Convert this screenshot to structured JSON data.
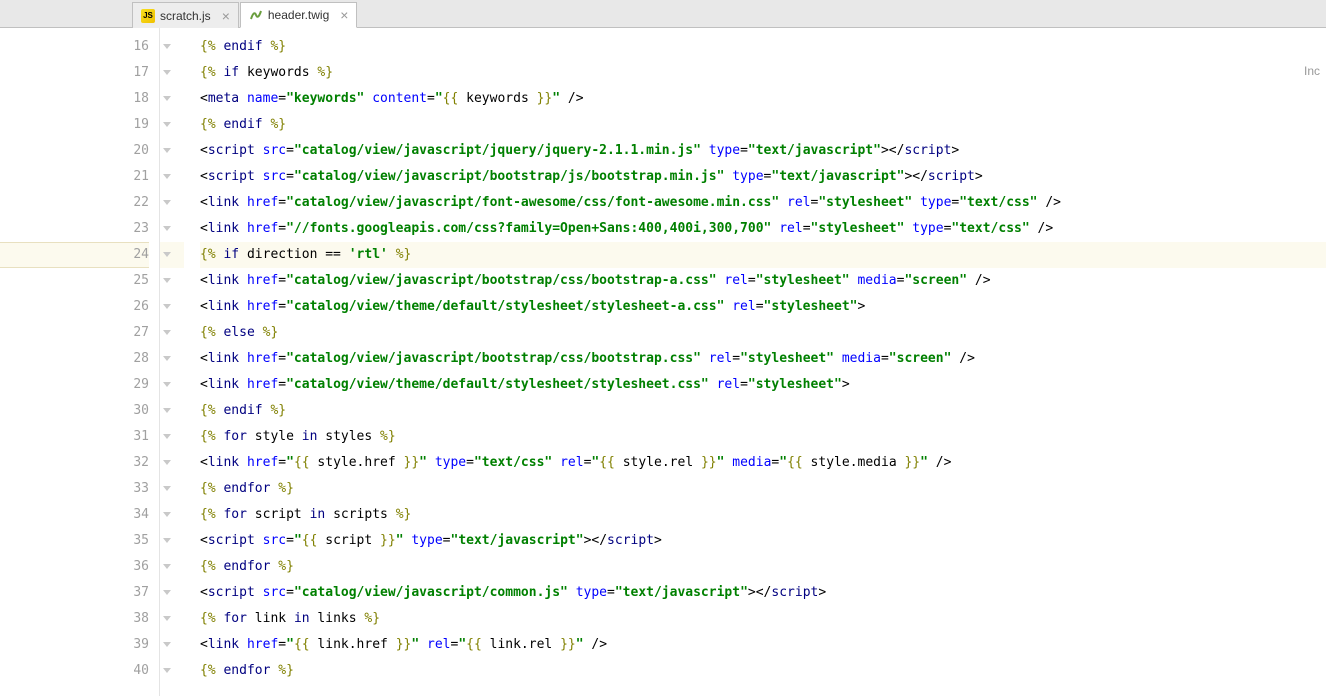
{
  "tabs": [
    {
      "label": "scratch.js",
      "active": false,
      "icon": "js"
    },
    {
      "label": "header.twig",
      "active": true,
      "icon": "twig"
    }
  ],
  "hint": "Inc",
  "gutter_start": 16,
  "lines": [
    [
      [
        "{%",
        "twig"
      ],
      [
        " ",
        "d"
      ],
      [
        "endif",
        "twigkw"
      ],
      [
        " ",
        "d"
      ],
      [
        "%}",
        "twig"
      ]
    ],
    [
      [
        "{%",
        "twig"
      ],
      [
        " ",
        "d"
      ],
      [
        "if",
        "twigkw"
      ],
      [
        " ",
        "d"
      ],
      [
        "keywords",
        "var"
      ],
      [
        " ",
        "d"
      ],
      [
        "%}",
        "twig"
      ]
    ],
    [
      [
        "<",
        "p"
      ],
      [
        "meta",
        "tag"
      ],
      [
        " ",
        "d"
      ],
      [
        "name",
        "attr"
      ],
      [
        "=",
        "p"
      ],
      [
        "\"keywords\"",
        "str"
      ],
      [
        " ",
        "d"
      ],
      [
        "content",
        "attr"
      ],
      [
        "=",
        "p"
      ],
      [
        "\"",
        "str"
      ],
      [
        "{{",
        "twig"
      ],
      [
        " keywords ",
        "var"
      ],
      [
        "}}",
        "twig"
      ],
      [
        "\"",
        "str"
      ],
      [
        " />",
        "p"
      ]
    ],
    [
      [
        "{%",
        "twig"
      ],
      [
        " ",
        "d"
      ],
      [
        "endif",
        "twigkw"
      ],
      [
        " ",
        "d"
      ],
      [
        "%}",
        "twig"
      ]
    ],
    [
      [
        "<",
        "p"
      ],
      [
        "script",
        "tag"
      ],
      [
        " ",
        "d"
      ],
      [
        "src",
        "attr"
      ],
      [
        "=",
        "p"
      ],
      [
        "\"catalog/view/javascript/jquery/jquery-2.1.1.min.js\"",
        "str"
      ],
      [
        " ",
        "d"
      ],
      [
        "type",
        "attr"
      ],
      [
        "=",
        "p"
      ],
      [
        "\"text/javascript\"",
        "str"
      ],
      [
        "></",
        "p"
      ],
      [
        "script",
        "tag"
      ],
      [
        ">",
        "p"
      ]
    ],
    [
      [
        "<",
        "p"
      ],
      [
        "script",
        "tag"
      ],
      [
        " ",
        "d"
      ],
      [
        "src",
        "attr"
      ],
      [
        "=",
        "p"
      ],
      [
        "\"catalog/view/javascript/bootstrap/js/bootstrap.min.js\"",
        "str"
      ],
      [
        " ",
        "d"
      ],
      [
        "type",
        "attr"
      ],
      [
        "=",
        "p"
      ],
      [
        "\"text/javascript\"",
        "str"
      ],
      [
        "></",
        "p"
      ],
      [
        "script",
        "tag"
      ],
      [
        ">",
        "p"
      ]
    ],
    [
      [
        "<",
        "p"
      ],
      [
        "link",
        "tag"
      ],
      [
        " ",
        "d"
      ],
      [
        "href",
        "attr"
      ],
      [
        "=",
        "p"
      ],
      [
        "\"catalog/view/javascript/font-awesome/css/font-awesome.min.css\"",
        "str"
      ],
      [
        " ",
        "d"
      ],
      [
        "rel",
        "attr"
      ],
      [
        "=",
        "p"
      ],
      [
        "\"stylesheet\"",
        "str"
      ],
      [
        " ",
        "d"
      ],
      [
        "type",
        "attr"
      ],
      [
        "=",
        "p"
      ],
      [
        "\"text/css\"",
        "str"
      ],
      [
        " />",
        "p"
      ]
    ],
    [
      [
        "<",
        "p"
      ],
      [
        "link",
        "tag"
      ],
      [
        " ",
        "d"
      ],
      [
        "href",
        "attr"
      ],
      [
        "=",
        "p"
      ],
      [
        "\"//fonts.googleapis.com/css?family=Open+Sans:400,400i,300,700\"",
        "str"
      ],
      [
        " ",
        "d"
      ],
      [
        "rel",
        "attr"
      ],
      [
        "=",
        "p"
      ],
      [
        "\"stylesheet\"",
        "str"
      ],
      [
        " ",
        "d"
      ],
      [
        "type",
        "attr"
      ],
      [
        "=",
        "p"
      ],
      [
        "\"text/css\"",
        "str"
      ],
      [
        " />",
        "p"
      ]
    ],
    [
      [
        "{%",
        "twig"
      ],
      [
        " ",
        "d"
      ],
      [
        "if",
        "twigkw"
      ],
      [
        " ",
        "d"
      ],
      [
        "direction == ",
        "var"
      ],
      [
        "'rtl'",
        "str"
      ],
      [
        " ",
        "d"
      ],
      [
        "%}",
        "twig"
      ]
    ],
    [
      [
        "<",
        "p"
      ],
      [
        "link",
        "tag"
      ],
      [
        " ",
        "d"
      ],
      [
        "href",
        "attr"
      ],
      [
        "=",
        "p"
      ],
      [
        "\"catalog/view/javascript/bootstrap/css/bootstrap-a.css\"",
        "str"
      ],
      [
        " ",
        "d"
      ],
      [
        "rel",
        "attr"
      ],
      [
        "=",
        "p"
      ],
      [
        "\"stylesheet\"",
        "str"
      ],
      [
        " ",
        "d"
      ],
      [
        "media",
        "attr"
      ],
      [
        "=",
        "p"
      ],
      [
        "\"screen\"",
        "str"
      ],
      [
        " />",
        "p"
      ]
    ],
    [
      [
        "<",
        "p"
      ],
      [
        "link",
        "tag"
      ],
      [
        " ",
        "d"
      ],
      [
        "href",
        "attr"
      ],
      [
        "=",
        "p"
      ],
      [
        "\"catalog/view/theme/default/stylesheet/stylesheet-a.css\"",
        "str"
      ],
      [
        " ",
        "d"
      ],
      [
        "rel",
        "attr"
      ],
      [
        "=",
        "p"
      ],
      [
        "\"stylesheet\"",
        "str"
      ],
      [
        ">",
        "p"
      ]
    ],
    [
      [
        "{%",
        "twig"
      ],
      [
        " ",
        "d"
      ],
      [
        "else",
        "twigkw"
      ],
      [
        " ",
        "d"
      ],
      [
        "%}",
        "twig"
      ]
    ],
    [
      [
        "<",
        "p"
      ],
      [
        "link",
        "tag"
      ],
      [
        " ",
        "d"
      ],
      [
        "href",
        "attr"
      ],
      [
        "=",
        "p"
      ],
      [
        "\"catalog/view/javascript/bootstrap/css/bootstrap.css\"",
        "str"
      ],
      [
        " ",
        "d"
      ],
      [
        "rel",
        "attr"
      ],
      [
        "=",
        "p"
      ],
      [
        "\"stylesheet\"",
        "str"
      ],
      [
        " ",
        "d"
      ],
      [
        "media",
        "attr"
      ],
      [
        "=",
        "p"
      ],
      [
        "\"screen\"",
        "str"
      ],
      [
        " />",
        "p"
      ]
    ],
    [
      [
        "<",
        "p"
      ],
      [
        "link",
        "tag"
      ],
      [
        " ",
        "d"
      ],
      [
        "href",
        "attr"
      ],
      [
        "=",
        "p"
      ],
      [
        "\"catalog/view/theme/default/stylesheet/stylesheet.css\"",
        "str"
      ],
      [
        " ",
        "d"
      ],
      [
        "rel",
        "attr"
      ],
      [
        "=",
        "p"
      ],
      [
        "\"stylesheet\"",
        "str"
      ],
      [
        ">",
        "p"
      ]
    ],
    [
      [
        "{%",
        "twig"
      ],
      [
        " ",
        "d"
      ],
      [
        "endif",
        "twigkw"
      ],
      [
        " ",
        "d"
      ],
      [
        "%}",
        "twig"
      ]
    ],
    [
      [
        "{%",
        "twig"
      ],
      [
        " ",
        "d"
      ],
      [
        "for",
        "twigkw"
      ],
      [
        " ",
        "d"
      ],
      [
        "style",
        "var"
      ],
      [
        " ",
        "d"
      ],
      [
        "in",
        "twigkw"
      ],
      [
        " ",
        "d"
      ],
      [
        "styles",
        "var"
      ],
      [
        " ",
        "d"
      ],
      [
        "%}",
        "twig"
      ]
    ],
    [
      [
        "<",
        "p"
      ],
      [
        "link",
        "tag"
      ],
      [
        " ",
        "d"
      ],
      [
        "href",
        "attr"
      ],
      [
        "=",
        "p"
      ],
      [
        "\"",
        "str"
      ],
      [
        "{{",
        "twig"
      ],
      [
        " style.href ",
        "var"
      ],
      [
        "}}",
        "twig"
      ],
      [
        "\"",
        "str"
      ],
      [
        " ",
        "d"
      ],
      [
        "type",
        "attr"
      ],
      [
        "=",
        "p"
      ],
      [
        "\"text/css\"",
        "str"
      ],
      [
        " ",
        "d"
      ],
      [
        "rel",
        "attr"
      ],
      [
        "=",
        "p"
      ],
      [
        "\"",
        "str"
      ],
      [
        "{{",
        "twig"
      ],
      [
        " style.rel ",
        "var"
      ],
      [
        "}}",
        "twig"
      ],
      [
        "\"",
        "str"
      ],
      [
        " ",
        "d"
      ],
      [
        "media",
        "attr"
      ],
      [
        "=",
        "p"
      ],
      [
        "\"",
        "str"
      ],
      [
        "{{",
        "twig"
      ],
      [
        " style.media ",
        "var"
      ],
      [
        "}}",
        "twig"
      ],
      [
        "\"",
        "str"
      ],
      [
        " />",
        "p"
      ]
    ],
    [
      [
        "{%",
        "twig"
      ],
      [
        " ",
        "d"
      ],
      [
        "endfor",
        "twigkw"
      ],
      [
        " ",
        "d"
      ],
      [
        "%}",
        "twig"
      ]
    ],
    [
      [
        "{%",
        "twig"
      ],
      [
        " ",
        "d"
      ],
      [
        "for",
        "twigkw"
      ],
      [
        " ",
        "d"
      ],
      [
        "script",
        "var"
      ],
      [
        " ",
        "d"
      ],
      [
        "in",
        "twigkw"
      ],
      [
        " ",
        "d"
      ],
      [
        "scripts",
        "var"
      ],
      [
        " ",
        "d"
      ],
      [
        "%}",
        "twig"
      ]
    ],
    [
      [
        "<",
        "p"
      ],
      [
        "script",
        "tag"
      ],
      [
        " ",
        "d"
      ],
      [
        "src",
        "attr"
      ],
      [
        "=",
        "p"
      ],
      [
        "\"",
        "str"
      ],
      [
        "{{",
        "twig"
      ],
      [
        " script ",
        "var"
      ],
      [
        "}}",
        "twig"
      ],
      [
        "\"",
        "str"
      ],
      [
        " ",
        "d"
      ],
      [
        "type",
        "attr"
      ],
      [
        "=",
        "p"
      ],
      [
        "\"text/javascript\"",
        "str"
      ],
      [
        "></",
        "p"
      ],
      [
        "script",
        "tag"
      ],
      [
        ">",
        "p"
      ]
    ],
    [
      [
        "{%",
        "twig"
      ],
      [
        " ",
        "d"
      ],
      [
        "endfor",
        "twigkw"
      ],
      [
        " ",
        "d"
      ],
      [
        "%}",
        "twig"
      ]
    ],
    [
      [
        "<",
        "p"
      ],
      [
        "script",
        "tag"
      ],
      [
        " ",
        "d"
      ],
      [
        "src",
        "attr"
      ],
      [
        "=",
        "p"
      ],
      [
        "\"catalog/view/javascript/common.js\"",
        "str"
      ],
      [
        " ",
        "d"
      ],
      [
        "type",
        "attr"
      ],
      [
        "=",
        "p"
      ],
      [
        "\"text/javascript\"",
        "str"
      ],
      [
        "></",
        "p"
      ],
      [
        "script",
        "tag"
      ],
      [
        ">",
        "p"
      ]
    ],
    [
      [
        "{%",
        "twig"
      ],
      [
        " ",
        "d"
      ],
      [
        "for",
        "twigkw"
      ],
      [
        " ",
        "d"
      ],
      [
        "link",
        "var"
      ],
      [
        " ",
        "d"
      ],
      [
        "in",
        "twigkw"
      ],
      [
        " ",
        "d"
      ],
      [
        "links",
        "var"
      ],
      [
        " ",
        "d"
      ],
      [
        "%}",
        "twig"
      ]
    ],
    [
      [
        "<",
        "p"
      ],
      [
        "link",
        "tag"
      ],
      [
        " ",
        "d"
      ],
      [
        "href",
        "attr"
      ],
      [
        "=",
        "p"
      ],
      [
        "\"",
        "str"
      ],
      [
        "{{",
        "twig"
      ],
      [
        " link.href ",
        "var"
      ],
      [
        "}}",
        "twig"
      ],
      [
        "\"",
        "str"
      ],
      [
        " ",
        "d"
      ],
      [
        "rel",
        "attr"
      ],
      [
        "=",
        "p"
      ],
      [
        "\"",
        "str"
      ],
      [
        "{{",
        "twig"
      ],
      [
        " link.rel ",
        "var"
      ],
      [
        "}}",
        "twig"
      ],
      [
        "\"",
        "str"
      ],
      [
        " />",
        "p"
      ]
    ],
    [
      [
        "{%",
        "twig"
      ],
      [
        " ",
        "d"
      ],
      [
        "endfor",
        "twigkw"
      ],
      [
        " ",
        "d"
      ],
      [
        "%}",
        "twig"
      ]
    ]
  ],
  "current_line_index": 8
}
